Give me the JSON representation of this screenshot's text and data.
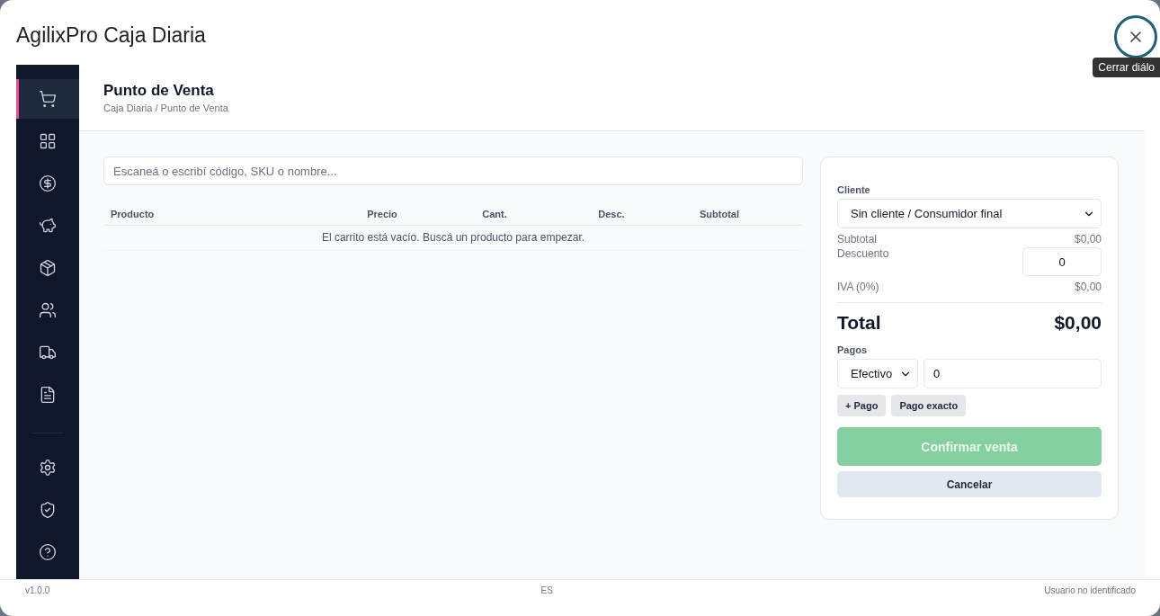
{
  "dialog": {
    "title": "AgilixPro Caja Diaria",
    "close_tooltip": "Cerrar diálo"
  },
  "sidebar": {
    "items": [
      {
        "selected": true
      },
      {
        "selected": false
      },
      {
        "selected": false
      },
      {
        "selected": false
      },
      {
        "selected": false
      },
      {
        "selected": false
      },
      {
        "selected": false
      },
      {
        "selected": false
      }
    ],
    "bottom_items": [
      {
        "selected": false
      },
      {
        "selected": false
      },
      {
        "selected": false
      }
    ]
  },
  "page": {
    "title": "Punto de Venta",
    "breadcrumb": "Caja Diaria / Punto de Venta"
  },
  "search": {
    "placeholder": "Escaneá o escribí código, SKU o nombre..."
  },
  "table": {
    "columns": [
      "Producto",
      "Precio",
      "Cant.",
      "Desc.",
      "Subtotal"
    ],
    "empty_message": "El carrito está vacío. Buscá un producto para empezar."
  },
  "summary": {
    "client_label": "Cliente",
    "client_value": "Sin cliente / Consumidor final",
    "subtotal_label": "Subtotal",
    "subtotal_value": "$0,00",
    "discount_label": "Descuento",
    "discount_value": "0",
    "tax_label": "IVA (0%)",
    "tax_value": "$0,00",
    "total_label": "Total",
    "total_value": "$0,00",
    "payments_label": "Pagos",
    "payment_method": "Efectivo",
    "payment_amount": "0",
    "add_payment": "+ Pago",
    "exact_payment": "Pago exacto",
    "confirm": {
      "label": "Confirmar venta",
      "disabled": true
    },
    "cancel": "Cancelar"
  },
  "status_bar": {
    "version": "v1.0.0",
    "language": "ES",
    "user": "Usuario no identificado"
  }
}
